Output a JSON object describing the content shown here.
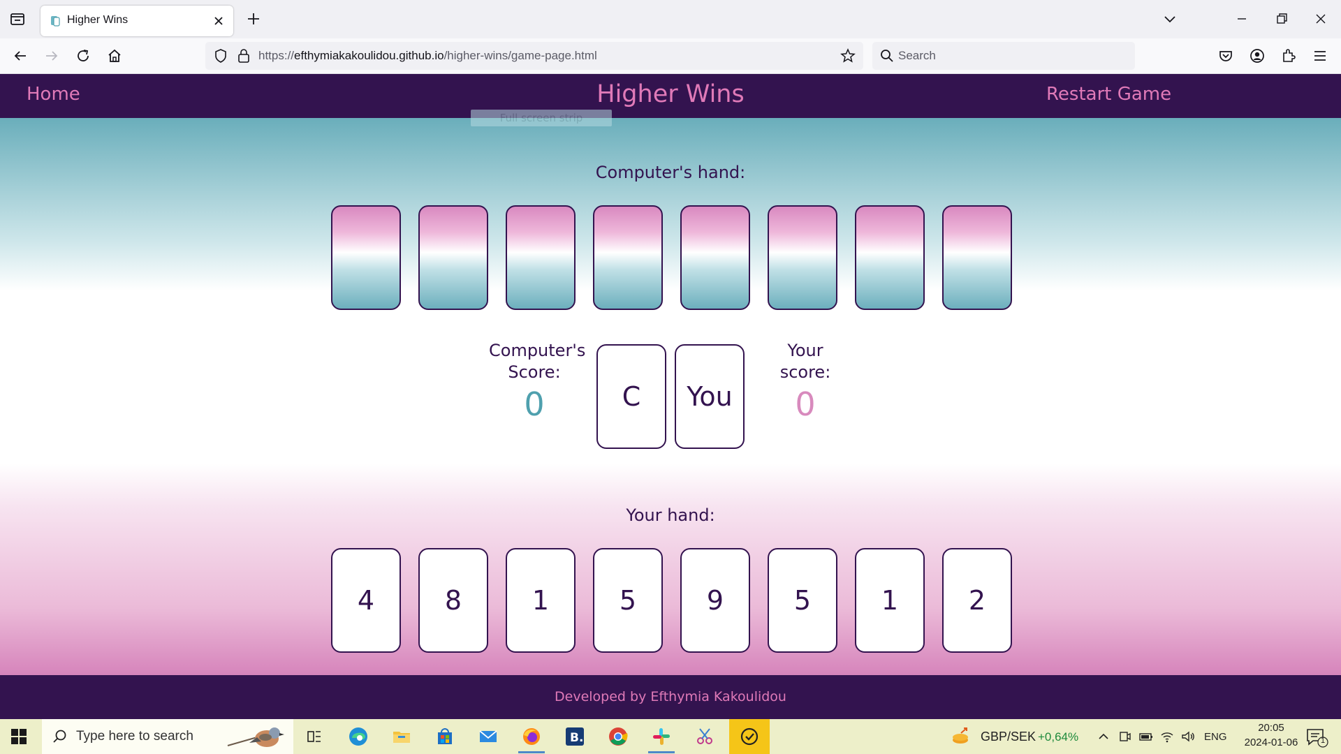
{
  "browser": {
    "tab_title": "Higher Wins",
    "url_prefix": "https://",
    "url_host": "efthymiakakoulidou.github.io",
    "url_path": "/higher-wins/game-page.html",
    "search_placeholder": "Search"
  },
  "site": {
    "home_link": "Home",
    "title": "Higher Wins",
    "restart_link": "Restart Game",
    "tooltip": "Full screen strip"
  },
  "game": {
    "computer_hand_label": "Computer's hand:",
    "computer_cards_count": 8,
    "computer_score_label_line1": "Computer's",
    "computer_score_label_line2": "Score:",
    "computer_score": "0",
    "computer_played_card": "C",
    "player_played_card": "You",
    "player_score_label_line1": "Your",
    "player_score_label_line2": "score:",
    "player_score": "0",
    "player_hand_label": "Your hand:",
    "player_cards": [
      "4",
      "8",
      "1",
      "5",
      "9",
      "5",
      "1",
      "2"
    ]
  },
  "footer": {
    "text": "Developed by Efthymia Kakoulidou"
  },
  "taskbar": {
    "search_placeholder": "Type here to search",
    "ticker_label": "GBP/SEK",
    "ticker_change": "+0,64%",
    "language": "ENG",
    "time": "20:05",
    "date": "2024-01-06",
    "notification_count": "1"
  },
  "colors": {
    "header_bg": "#33134f",
    "accent_pink": "#e07ab8",
    "teal": "#4fa0ae",
    "score_pink": "#d88abd"
  }
}
